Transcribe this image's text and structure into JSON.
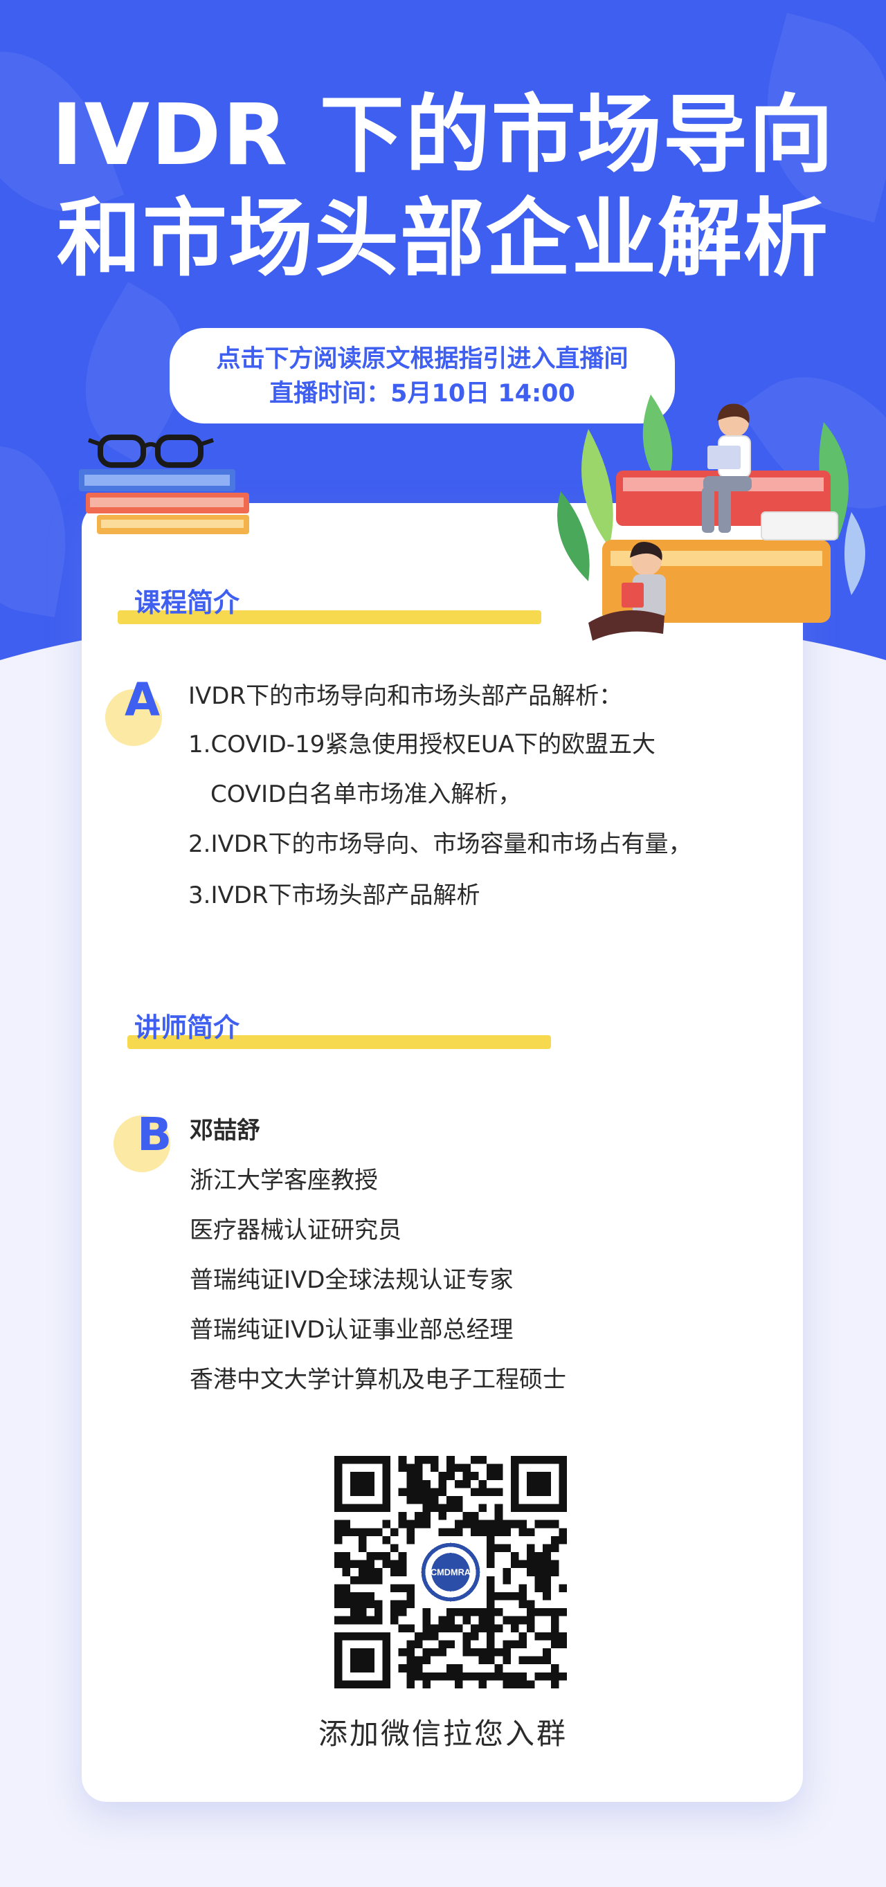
{
  "header": {
    "title_line1": "IVDR 下的市场导向",
    "title_line2": "和市场头部企业解析",
    "notice_line1": "点击下方阅读原文根据指引进入直播间",
    "notice_line2": "直播时间：5月10日  14:00"
  },
  "course": {
    "section_title": "课程简介",
    "badge": "A",
    "lines": [
      "IVDR下的市场导向和市场头部产品解析：",
      "1.COVID-19紧急使用授权EUA下的欧盟五大",
      "COVID白名单市场准入解析，",
      "2.IVDR下的市场导向、市场容量和市场占有量，",
      "3.IVDR下市场头部产品解析"
    ]
  },
  "lecturer": {
    "section_title": "讲师简介",
    "badge": "B",
    "name": "邓喆舒",
    "lines": [
      "浙江大学客座教授",
      "医疗器械认证研究员",
      "普瑞纯证IVD全球法规认证专家",
      "普瑞纯证IVD认证事业部总经理",
      "香港中文大学计算机及电子工程硕士"
    ]
  },
  "qr": {
    "caption": "添加微信拉您入群",
    "logo_text": "CMDMRA"
  },
  "colors": {
    "brand_blue": "#3f5ff0",
    "highlight_yellow": "#f7d94f",
    "badge_yellow": "#fbe9a4"
  },
  "icons": [
    "glasses-icon",
    "book-stack-icon",
    "reading-people-illustration",
    "qr-code-icon"
  ]
}
